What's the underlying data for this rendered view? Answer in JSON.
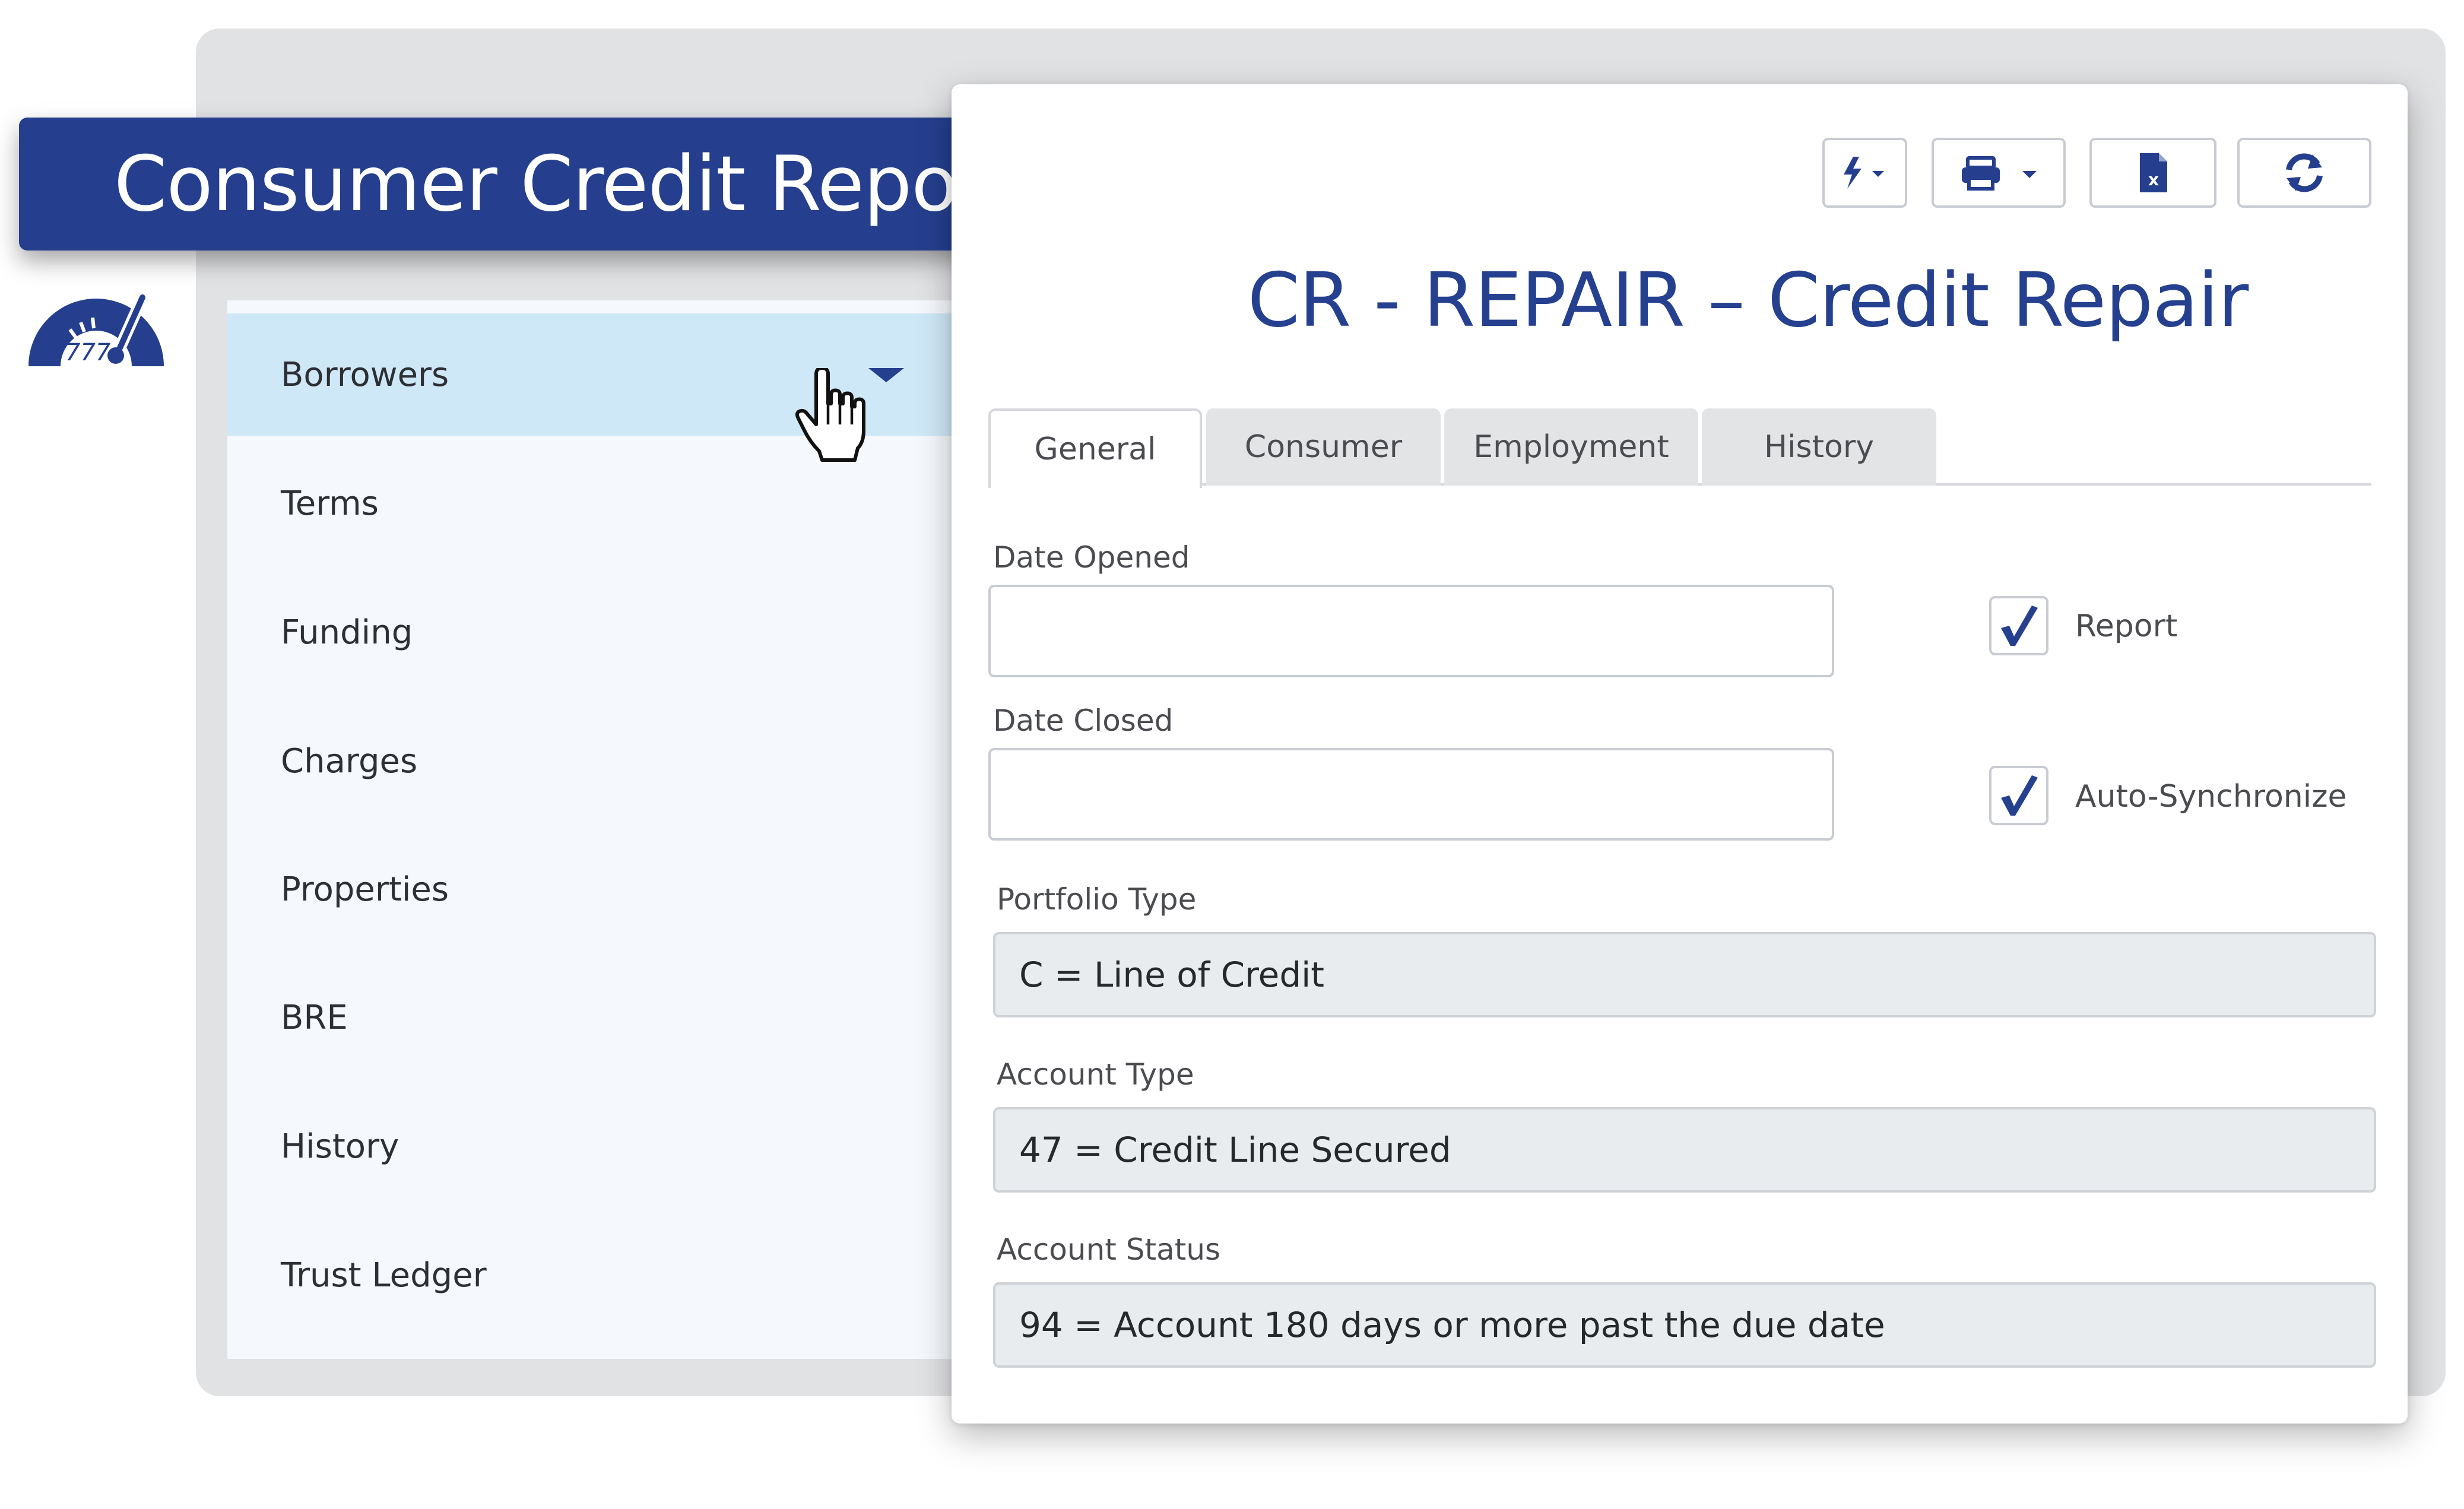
{
  "banner": {
    "title": "Consumer Credit Reporting"
  },
  "sidebar": {
    "items": [
      {
        "label": "Borrowers"
      },
      {
        "label": "Terms"
      },
      {
        "label": "Funding"
      },
      {
        "label": "Charges"
      },
      {
        "label": "Properties"
      },
      {
        "label": "BRE"
      },
      {
        "label": "History"
      },
      {
        "label": "Trust Ledger"
      }
    ],
    "active_item": "Borrowers"
  },
  "toolbar": {
    "buttons": [
      {
        "icon": "lightning-icon",
        "has_dropdown": true
      },
      {
        "icon": "printer-icon",
        "has_dropdown": true
      },
      {
        "icon": "excel-icon",
        "has_dropdown": false
      },
      {
        "icon": "refresh-icon",
        "has_dropdown": false
      }
    ]
  },
  "form": {
    "title": "CR - REPAIR – Credit Repair",
    "tabs": [
      {
        "label": "General"
      },
      {
        "label": "Consumer"
      },
      {
        "label": "Employment"
      },
      {
        "label": "History"
      }
    ],
    "active_tab": "General",
    "date_opened": {
      "label": "Date Opened",
      "value": ""
    },
    "date_closed": {
      "label": "Date Closed",
      "value": ""
    },
    "report": {
      "label": "Report",
      "checked": true
    },
    "auto_sync": {
      "label": "Auto-Synchronize",
      "checked": true
    },
    "portfolio_type": {
      "label": "Portfolio Type",
      "value": "C = Line of Credit"
    },
    "account_type": {
      "label": "Account Type",
      "value": "47 = Credit Line Secured"
    },
    "account_status": {
      "label": "Account Status",
      "value": "94 = Account 180 days or more past the due date"
    }
  },
  "colors": {
    "brand": "#253f8e",
    "sidebar_active": "#cfe8f8",
    "checkmark": "#25408f"
  }
}
